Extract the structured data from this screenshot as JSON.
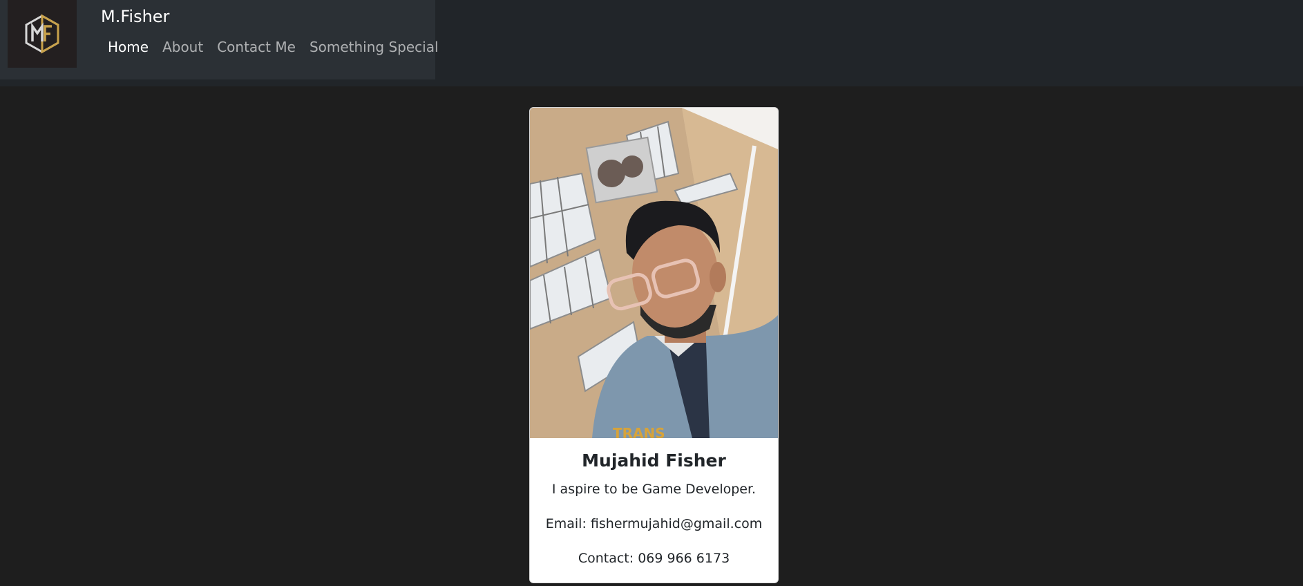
{
  "brand": {
    "name": "M.Fisher",
    "logo_text": "MF"
  },
  "nav": {
    "items": [
      {
        "label": "Home",
        "active": true
      },
      {
        "label": "About",
        "active": false
      },
      {
        "label": "Contact Me",
        "active": false
      },
      {
        "label": "Something Special",
        "active": false
      }
    ]
  },
  "profile": {
    "name": "Mujahid Fisher",
    "tagline": "I aspire to be Game Developer.",
    "email": "Email: fishermujahid@gmail.com",
    "contact": "Contact: 069 966 6173"
  },
  "colors": {
    "page_bg": "#1e1e1e",
    "topbar_bg": "#212529",
    "navbox_bg": "#2b3035",
    "logo_gold": "#c9a24a",
    "logo_silver": "#d7d7d7"
  }
}
